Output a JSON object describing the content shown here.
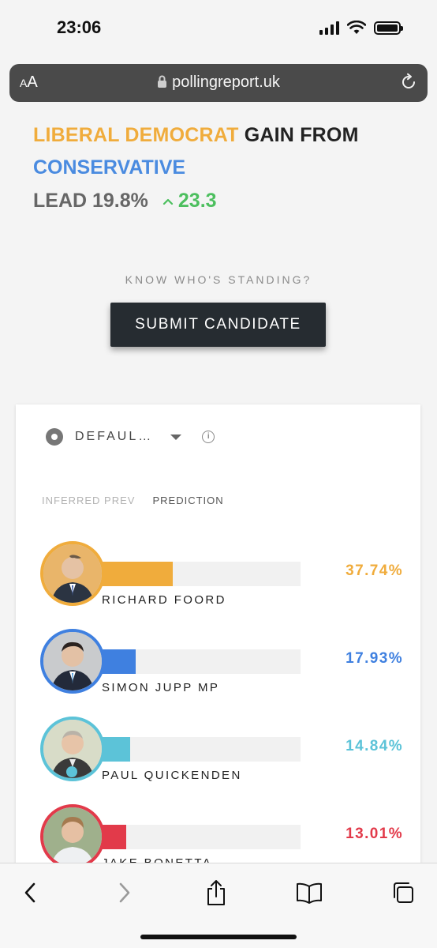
{
  "status_bar": {
    "time": "23:06"
  },
  "browser": {
    "aa_label_small": "A",
    "aa_label_large": "A",
    "url": "pollingreport.uk"
  },
  "result": {
    "gaining_party": "LIBERAL DEMOCRAT",
    "gain_from_text": "GAIN FROM",
    "losing_party": "CONSERVATIVE",
    "lead_text": "LEAD 19.8%",
    "change_value": "23.3",
    "colors": {
      "gaining": "#f0ac3c",
      "losing": "#4a8be0",
      "change": "#4cbf5e"
    }
  },
  "cta": {
    "prompt": "KNOW WHO'S STANDING?",
    "button_label": "SUBMIT CANDIDATE"
  },
  "card": {
    "scenario_label": "DEFAUL…",
    "tabs": [
      {
        "label": "INFERRED PREV",
        "active": false
      },
      {
        "label": "PREDICTION",
        "active": true
      }
    ],
    "candidates": [
      {
        "name": "RICHARD FOORD",
        "percent_text": "37.74%",
        "share": 0.3774,
        "color": "#f0ac3c"
      },
      {
        "name": "SIMON JUPP MP",
        "percent_text": "17.93%",
        "share": 0.1793,
        "color": "#3f80e0"
      },
      {
        "name": "PAUL QUICKENDEN",
        "percent_text": "14.84%",
        "share": 0.1484,
        "color": "#5cc3d8"
      },
      {
        "name": "JAKE BONETTA",
        "percent_text": "13.01%",
        "share": 0.1301,
        "color": "#e23a4a"
      }
    ]
  },
  "toolbar": {
    "icons": [
      "back-icon",
      "forward-icon",
      "share-icon",
      "bookmarks-icon",
      "tabs-icon"
    ]
  }
}
